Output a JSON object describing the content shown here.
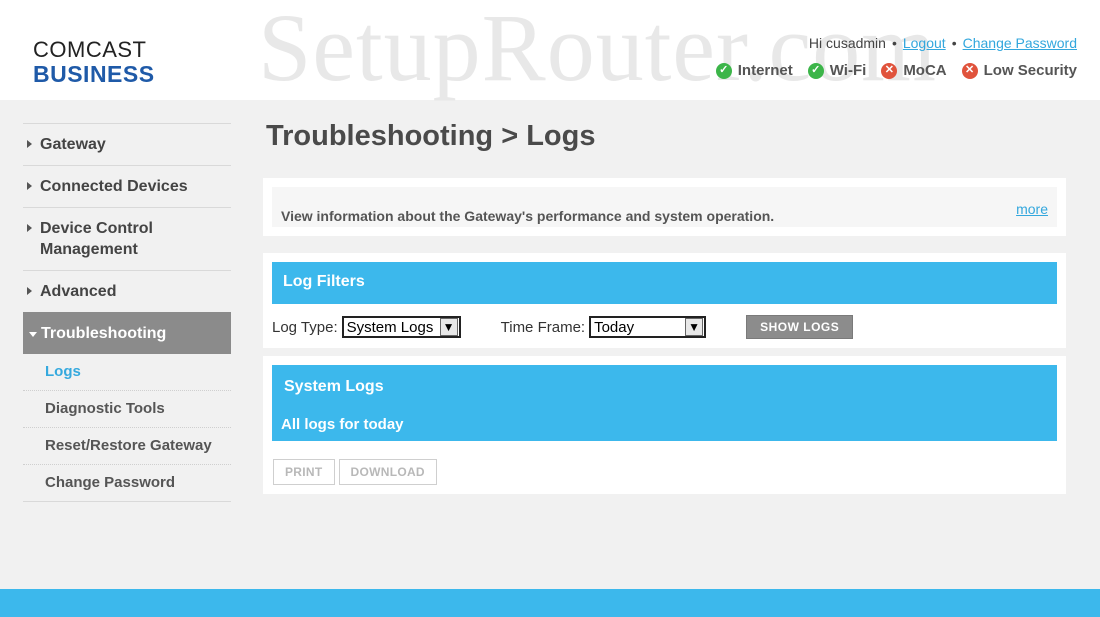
{
  "watermark": "SetupRouter.com",
  "logo": {
    "line1": "COMCAST",
    "line2": "BUSINESS"
  },
  "user": {
    "greeting": "Hi cusadmin",
    "logout": "Logout",
    "change_password": "Change Password"
  },
  "status": [
    {
      "label": "Internet",
      "state": "ok",
      "icon": "check-icon"
    },
    {
      "label": "Wi-Fi",
      "state": "ok",
      "icon": "check-icon"
    },
    {
      "label": "MoCA",
      "state": "bad",
      "icon": "x-icon"
    },
    {
      "label": "Low Security",
      "state": "bad",
      "icon": "x-icon"
    }
  ],
  "sidebar": {
    "items": [
      {
        "label": "Gateway"
      },
      {
        "label": "Connected Devices"
      },
      {
        "label": "Device Control Management"
      },
      {
        "label": "Advanced"
      },
      {
        "label": "Troubleshooting"
      }
    ],
    "sub_items": [
      {
        "label": "Logs"
      },
      {
        "label": "Diagnostic Tools"
      },
      {
        "label": "Reset/Restore Gateway"
      },
      {
        "label": "Change Password"
      }
    ]
  },
  "page": {
    "title": "Troubleshooting > Logs"
  },
  "info": {
    "text": "View information about the Gateway's performance and system operation.",
    "more": "more"
  },
  "filters": {
    "heading": "Log Filters",
    "log_type_label": "Log Type:",
    "log_type_value": "System Logs",
    "time_frame_label": "Time Frame:",
    "time_frame_value": "Today",
    "show_button": "SHOW LOGS"
  },
  "logs": {
    "heading": "System Logs",
    "subheading": "All logs for today",
    "print_button": "PRINT",
    "download_button": "DOWNLOAD"
  },
  "colors": {
    "accent": "#3cb8ec",
    "brand": "#1f5aa8",
    "ok": "#3cb549",
    "bad": "#e0533c"
  }
}
